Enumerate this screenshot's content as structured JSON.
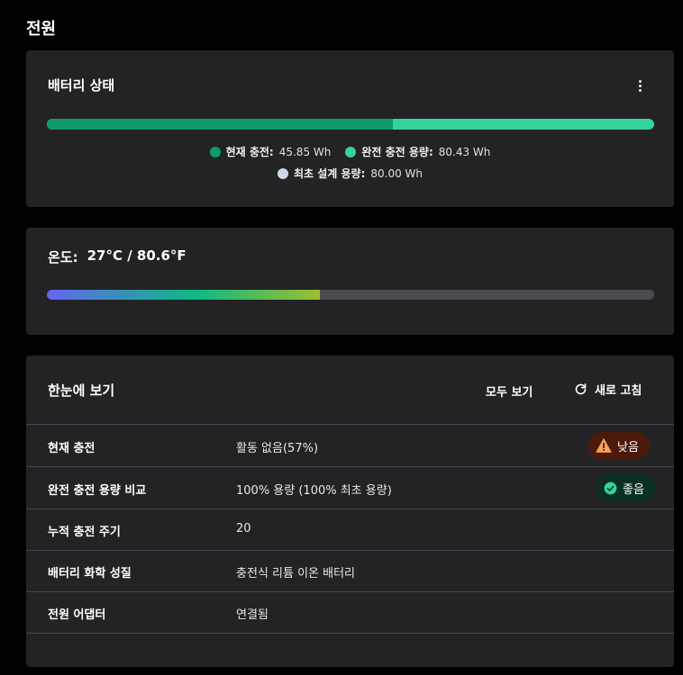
{
  "page": {
    "title": "전원"
  },
  "battery": {
    "title": "배터리 상태",
    "current_fraction": 0.57,
    "colors": {
      "current": "#0e9a6a",
      "full": "#34d399",
      "design": "#cfd8e6"
    },
    "legend": [
      {
        "key": "현재 충전:",
        "value": "45.85 Wh"
      },
      {
        "key": "완전 충전 용량:",
        "value": "80.43 Wh"
      },
      {
        "key": "최초 설계 용량:",
        "value": "80.00 Wh"
      }
    ]
  },
  "temperature": {
    "label": "온도:",
    "value": "27°C / 80.6°F",
    "level_fraction": 0.45
  },
  "glance": {
    "title": "한눈에 보기",
    "view_all": "모두 보기",
    "refresh": "새로 고침",
    "rows": [
      {
        "label": "현재 충전",
        "value": "활동 없음(57%)",
        "badge": "낮음",
        "badge_type": "warning"
      },
      {
        "label": "완전 충전 용량 비교",
        "value": "100% 용량 (100% 최초 용량)",
        "badge": "좋음",
        "badge_type": "good"
      },
      {
        "label": "누적 충전 주기",
        "value": "20"
      },
      {
        "label": "배터리 화학 성질",
        "value": "충전식 리튬 이온 배터리"
      },
      {
        "label": "전원 어댑터",
        "value": "연결됨"
      }
    ],
    "icons": {
      "refresh": "refresh-icon",
      "warning": "warning-icon",
      "good": "check-circle-icon",
      "menu": "kebab-menu-icon"
    }
  }
}
